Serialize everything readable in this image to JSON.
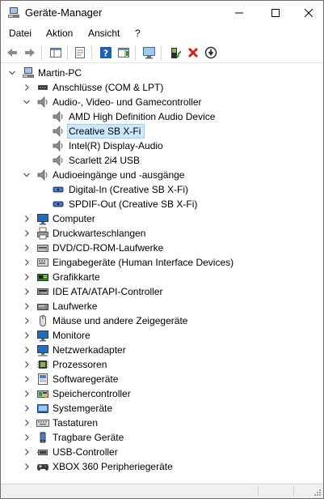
{
  "window": {
    "title": "Geräte-Manager",
    "controls": {
      "minimize": "minimize-icon",
      "maximize": "maximize-icon",
      "close": "close-icon"
    }
  },
  "menu": [
    {
      "label": "Datei"
    },
    {
      "label": "Aktion"
    },
    {
      "label": "Ansicht"
    },
    {
      "label": "?"
    }
  ],
  "toolbar": [
    {
      "icon": "back-arrow-icon"
    },
    {
      "icon": "forward-arrow-icon"
    },
    {
      "icon": "show-hide-console-tree-icon"
    },
    {
      "icon": "properties-icon"
    },
    {
      "icon": "help-icon"
    },
    {
      "icon": "action-pane-icon"
    },
    {
      "icon": "scan-hardware-icon"
    },
    {
      "icon": "update-driver-icon"
    },
    {
      "icon": "uninstall-device-icon"
    },
    {
      "icon": "disable-device-icon"
    }
  ],
  "tree": {
    "root": {
      "label": "Martin-PC",
      "icon": "computer-icon",
      "expanded": true
    },
    "nodes": [
      {
        "level": 1,
        "label": "Anschlüsse (COM & LPT)",
        "icon": "port-icon",
        "expanded": false
      },
      {
        "level": 1,
        "label": "Audio-, Video- und Gamecontroller",
        "icon": "speaker-icon",
        "expanded": true
      },
      {
        "level": 2,
        "label": "AMD High Definition Audio Device",
        "icon": "speaker-icon"
      },
      {
        "level": 2,
        "label": "Creative SB X-Fi",
        "icon": "speaker-icon",
        "selected": true
      },
      {
        "level": 2,
        "label": "Intel(R) Display-Audio",
        "icon": "speaker-icon"
      },
      {
        "level": 2,
        "label": "Scarlett 2i4 USB",
        "icon": "speaker-icon"
      },
      {
        "level": 1,
        "label": "Audioeingänge und -ausgänge",
        "icon": "speaker-icon",
        "expanded": true
      },
      {
        "level": 2,
        "label": "Digital-In (Creative SB X-Fi)",
        "icon": "audio-port-icon"
      },
      {
        "level": 2,
        "label": "SPDIF-Out (Creative SB X-Fi)",
        "icon": "audio-port-icon"
      },
      {
        "level": 1,
        "label": "Computer",
        "icon": "monitor-icon",
        "expanded": false
      },
      {
        "level": 1,
        "label": "Druckwarteschlangen",
        "icon": "printer-icon",
        "expanded": false
      },
      {
        "level": 1,
        "label": "DVD/CD-ROM-Laufwerke",
        "icon": "disc-drive-icon",
        "expanded": false
      },
      {
        "level": 1,
        "label": "Eingabegeräte (Human Interface Devices)",
        "icon": "hid-icon",
        "expanded": false
      },
      {
        "level": 1,
        "label": "Grafikkarte",
        "icon": "display-adapter-icon",
        "expanded": false
      },
      {
        "level": 1,
        "label": "IDE ATA/ATAPI-Controller",
        "icon": "ide-controller-icon",
        "expanded": false
      },
      {
        "level": 1,
        "label": "Laufwerke",
        "icon": "hard-drive-icon",
        "expanded": false
      },
      {
        "level": 1,
        "label": "Mäuse und andere Zeigegeräte",
        "icon": "mouse-icon",
        "expanded": false
      },
      {
        "level": 1,
        "label": "Monitore",
        "icon": "monitor-icon",
        "expanded": false
      },
      {
        "level": 1,
        "label": "Netzwerkadapter",
        "icon": "network-adapter-icon",
        "expanded": false
      },
      {
        "level": 1,
        "label": "Prozessoren",
        "icon": "processor-icon",
        "expanded": false
      },
      {
        "level": 1,
        "label": "Softwaregeräte",
        "icon": "software-device-icon",
        "expanded": false
      },
      {
        "level": 1,
        "label": "Speichercontroller",
        "icon": "storage-controller-icon",
        "expanded": false
      },
      {
        "level": 1,
        "label": "Systemgeräte",
        "icon": "system-device-icon",
        "expanded": false
      },
      {
        "level": 1,
        "label": "Tastaturen",
        "icon": "keyboard-icon",
        "expanded": false
      },
      {
        "level": 1,
        "label": "Tragbare Geräte",
        "icon": "portable-device-icon",
        "expanded": false
      },
      {
        "level": 1,
        "label": "USB-Controller",
        "icon": "usb-icon",
        "expanded": false
      },
      {
        "level": 1,
        "label": "XBOX 360 Peripheriegeräte",
        "icon": "gamepad-icon",
        "expanded": false
      }
    ]
  },
  "colors": {
    "selection_bg": "#cce8ff",
    "selection_border": "#99d1ff",
    "accent_blue": "#1e6ec8",
    "uninstall_red": "#d9201f",
    "scan_green": "#2e9a3c"
  }
}
